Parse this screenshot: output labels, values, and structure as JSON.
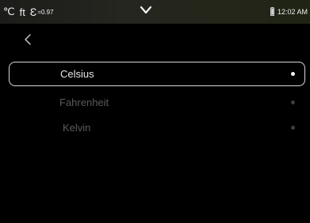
{
  "status_bar": {
    "temp_unit": "℃",
    "distance_unit": "ft",
    "emissivity_symbol": "Ɛ",
    "emissivity_value": "=0.97",
    "time": "12:02 AM",
    "battery_icon": "battery-icon",
    "dropdown_icon": "chevron-down-icon"
  },
  "nav": {
    "back_icon": "chevron-left-icon"
  },
  "options": [
    {
      "label": "Celsius",
      "selected": true
    },
    {
      "label": "Fahrenheit",
      "selected": false
    },
    {
      "label": "Kelvin",
      "selected": false
    }
  ],
  "colors": {
    "background": "#000000",
    "selected_border": "#d8d8d8",
    "dimmed_text": "#5a5a5a"
  }
}
